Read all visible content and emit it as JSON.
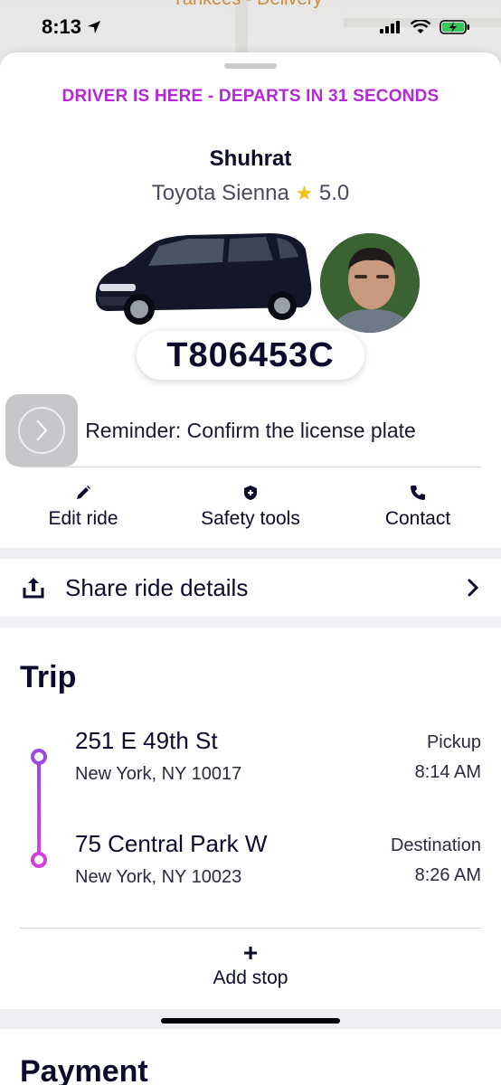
{
  "status_bar": {
    "time": "8:13"
  },
  "map": {
    "label": "Yankees - Delivery"
  },
  "banner": {
    "text": "DRIVER IS HERE - DEPARTS IN 31 SECONDS"
  },
  "driver": {
    "name": "Shuhrat",
    "car": "Toyota Sienna",
    "rating": "5.0",
    "plate": "T806453C"
  },
  "reminder": "Reminder: Confirm the license plate",
  "actions": [
    {
      "label": "Edit ride",
      "icon": "pencil-icon"
    },
    {
      "label": "Safety tools",
      "icon": "shield-icon"
    },
    {
      "label": "Contact",
      "icon": "phone-icon"
    }
  ],
  "share": {
    "label": "Share ride details"
  },
  "trip": {
    "title": "Trip",
    "pickup": {
      "address": "251 E 49th St",
      "city": "New York, NY 10017",
      "label": "Pickup",
      "time": "8:14 AM"
    },
    "destination": {
      "address": "75 Central Park W",
      "city": "New York, NY 10023",
      "label": "Destination",
      "time": "8:26 AM"
    },
    "add_stop": {
      "symbol": "+",
      "label": "Add stop"
    }
  },
  "payment": {
    "title": "Payment"
  },
  "colors": {
    "accent": "#b428d8",
    "route_start": "#9b4be0",
    "route_end": "#d63ee0",
    "star": "#f4c20d"
  }
}
